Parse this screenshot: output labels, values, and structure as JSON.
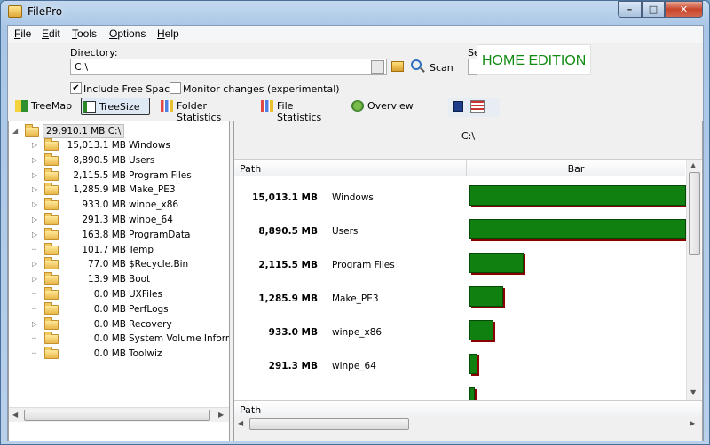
{
  "window": {
    "title": "FilePro",
    "min": "–",
    "max": "□",
    "close": "✕"
  },
  "menu": [
    "File",
    "Edit",
    "Tools",
    "Options",
    "Help"
  ],
  "toolbar": {
    "directory_label": "Directory:",
    "directory_value": "C:\\",
    "scan_label": "Scan",
    "se_label": "Se",
    "edition": "HOME EDITION",
    "include_free_space_label": "Include Free Space",
    "include_free_space_checked": true,
    "monitor_label": "Monitor changes (experimental)",
    "monitor_checked": false
  },
  "tabs": [
    {
      "label": "TreeMap",
      "icon": "treemap-icon",
      "active": false
    },
    {
      "label": "TreeSize",
      "icon": "treesize-icon",
      "active": true
    },
    {
      "label": "Folder Statistics",
      "icon": "bar-chart-icon",
      "active": false
    },
    {
      "label": "File Statistics",
      "icon": "bar-chart-icon",
      "active": false
    },
    {
      "label": "Overview",
      "icon": "overview-icon",
      "active": false
    }
  ],
  "tree": {
    "root": "29,910.1 MB C:\\",
    "items": [
      {
        "size": "15,013.1 MB",
        "name": "Windows",
        "expandable": true
      },
      {
        "size": "8,890.5 MB",
        "name": "Users",
        "expandable": true
      },
      {
        "size": "2,115.5 MB",
        "name": "Program Files",
        "expandable": true
      },
      {
        "size": "1,285.9 MB",
        "name": "Make_PE3",
        "expandable": true
      },
      {
        "size": "933.0 MB",
        "name": "winpe_x86",
        "expandable": true
      },
      {
        "size": "291.3 MB",
        "name": "winpe_64",
        "expandable": true
      },
      {
        "size": "163.8 MB",
        "name": "ProgramData",
        "expandable": true
      },
      {
        "size": "101.7 MB",
        "name": "Temp",
        "expandable": false
      },
      {
        "size": "77.0 MB",
        "name": "$Recycle.Bin",
        "expandable": true
      },
      {
        "size": "13.9 MB",
        "name": "Boot",
        "expandable": true
      },
      {
        "size": "0.0 MB",
        "name": "UXFiles",
        "expandable": false
      },
      {
        "size": "0.0 MB",
        "name": "PerfLogs",
        "expandable": false
      },
      {
        "size": "0.0 MB",
        "name": "Recovery",
        "expandable": true
      },
      {
        "size": "0.0 MB",
        "name": "System Volume Information",
        "expandable": false
      },
      {
        "size": "0.0 MB",
        "name": "Toolwiz",
        "expandable": false
      }
    ]
  },
  "detail": {
    "title": "C:\\",
    "col_path": "Path",
    "col_bar": "Bar",
    "footer_path": "Path",
    "rows": [
      {
        "size": "15,013.1 MB",
        "name": "Windows",
        "fraction": 1.0
      },
      {
        "size": "8,890.5 MB",
        "name": "Users",
        "fraction": 1.0
      },
      {
        "size": "2,115.5 MB",
        "name": "Program Files",
        "fraction": 0.25
      },
      {
        "size": "1,285.9 MB",
        "name": "Make_PE3",
        "fraction": 0.155
      },
      {
        "size": "933.0 MB",
        "name": "winpe_x86",
        "fraction": 0.11
      },
      {
        "size": "291.3 MB",
        "name": "winpe_64",
        "fraction": 0.035
      },
      {
        "size": "",
        "name": "",
        "fraction": 0.02
      }
    ]
  }
}
